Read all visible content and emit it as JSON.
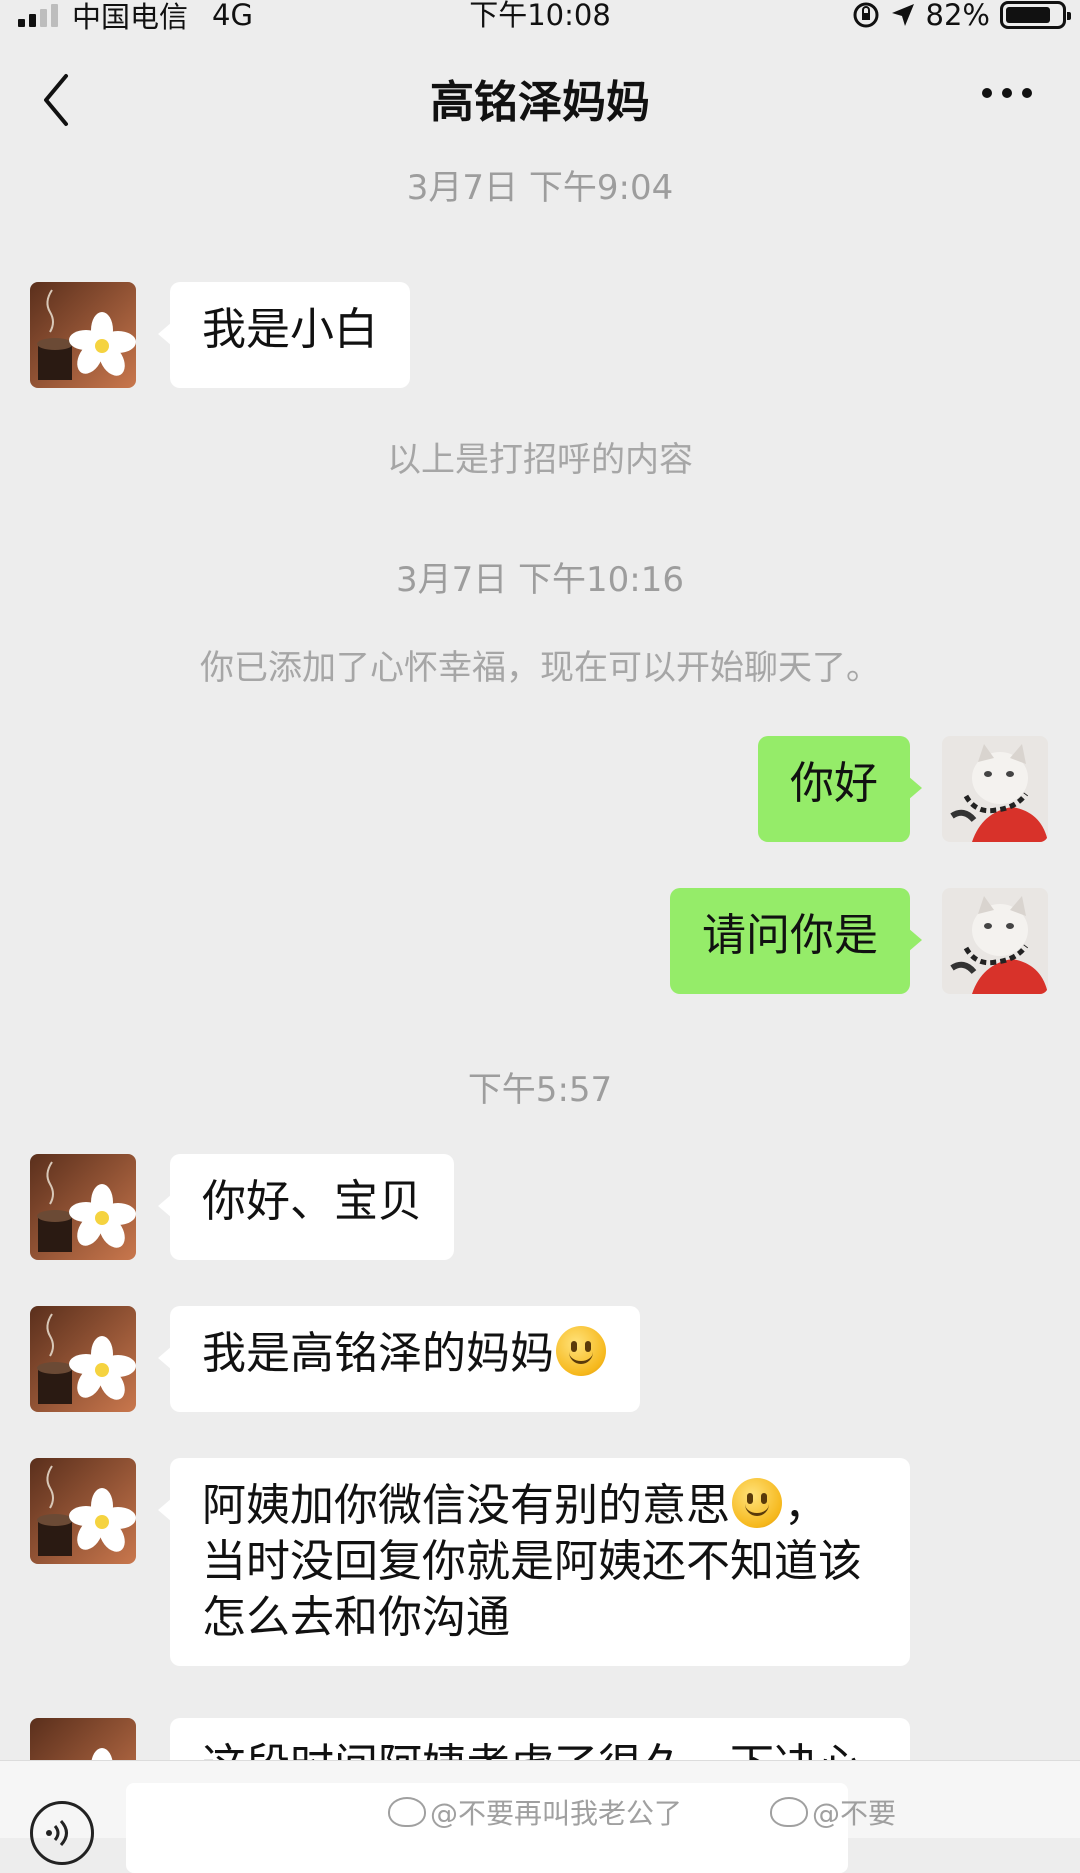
{
  "status_bar": {
    "carrier": "中国电信",
    "network": "4G",
    "time": "下午10:08",
    "battery": "82%",
    "battery_level": 0.82
  },
  "nav": {
    "title": "高铭泽妈妈"
  },
  "messages": [
    {
      "kind": "time",
      "text": "3月7日 下午9:04"
    },
    {
      "kind": "incoming",
      "text": "我是小白"
    },
    {
      "kind": "system",
      "text": "以上是打招呼的内容"
    },
    {
      "kind": "time",
      "text": "3月7日 下午10:16"
    },
    {
      "kind": "system",
      "text": "你已添加了心怀幸福，现在可以开始聊天了。"
    },
    {
      "kind": "outgoing",
      "text": "你好"
    },
    {
      "kind": "outgoing",
      "text": "请问你是"
    },
    {
      "kind": "time",
      "text": "下午5:57"
    },
    {
      "kind": "incoming",
      "text": "你好、宝贝"
    },
    {
      "kind": "incoming",
      "text": "我是高铭泽的妈妈",
      "emoji": "smile-emoji"
    },
    {
      "kind": "incoming",
      "lines": [
        "阿姨加你微信没有别的意思",
        "，",
        "当时没回复你就是阿姨还不知道该",
        "怎么去和你沟通"
      ],
      "emoji": "smile-emoji"
    },
    {
      "kind": "incoming",
      "text": "这段时间阿姨考虑了很久，下决心"
    }
  ],
  "watermarks": [
    "@不要再叫我老公了",
    "@不要"
  ],
  "icons": {
    "back": "chevron-left-icon",
    "more": "more-dots-icon",
    "voice": "voice-icon",
    "location": "location-arrow-icon",
    "lock_rotation": "rotation-lock-icon"
  },
  "colors": {
    "background": "#ededed",
    "incoming_bubble": "#ffffff",
    "outgoing_bubble": "#95ec69"
  }
}
